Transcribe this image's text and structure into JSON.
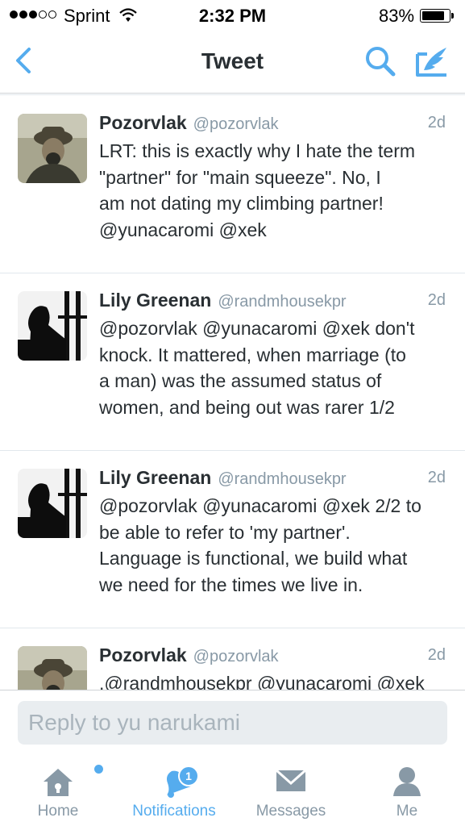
{
  "status_bar": {
    "carrier": "Sprint",
    "time": "2:32 PM",
    "battery_percent": "83%",
    "battery_level": 0.83,
    "signal_bars_filled": 3,
    "signal_bars_total": 5
  },
  "nav": {
    "title": "Tweet",
    "back_icon": "chevron-left-icon",
    "search_icon": "search-icon",
    "compose_icon": "compose-icon"
  },
  "tweets": [
    {
      "name": "Pozorvlak",
      "handle": "@pozorvlak",
      "time": "2d",
      "text": "LRT: this is exactly why I hate the term\n\"partner\" for \"main squeeze\". No, I\nam not dating my climbing partner!\n@yunacaromi @xek"
    },
    {
      "name": "Lily Greenan",
      "handle": "@randmhousekpr",
      "time": "2d",
      "text": "@pozorvlak @yunacaromi @xek don't\nknock. It mattered, when marriage (to\na man) was the assumed status of\nwomen, and being out was rarer 1/2"
    },
    {
      "name": "Lily Greenan",
      "handle": "@randmhousekpr",
      "time": "2d",
      "text": "@pozorvlak @yunacaromi @xek 2/2 to\nbe able to refer to 'my partner'.\nLanguage is functional, we build what\nwe need for the times we live in."
    },
    {
      "name": "Pozorvlak",
      "handle": "@pozorvlak",
      "time": "2d",
      "text": ".@randmhousekpr @yunacaromi @xek"
    }
  ],
  "reply": {
    "placeholder": "Reply to yu narukami"
  },
  "tabs": [
    {
      "label": "Home",
      "icon": "home-icon",
      "active": false
    },
    {
      "label": "Notifications",
      "icon": "bell-icon",
      "active": true,
      "badge": "1"
    },
    {
      "label": "Messages",
      "icon": "envelope-icon",
      "active": false
    },
    {
      "label": "Me",
      "icon": "person-icon",
      "active": false
    }
  ],
  "colors": {
    "accent": "#55acee",
    "text": "#292f33",
    "muted": "#8899a6"
  }
}
